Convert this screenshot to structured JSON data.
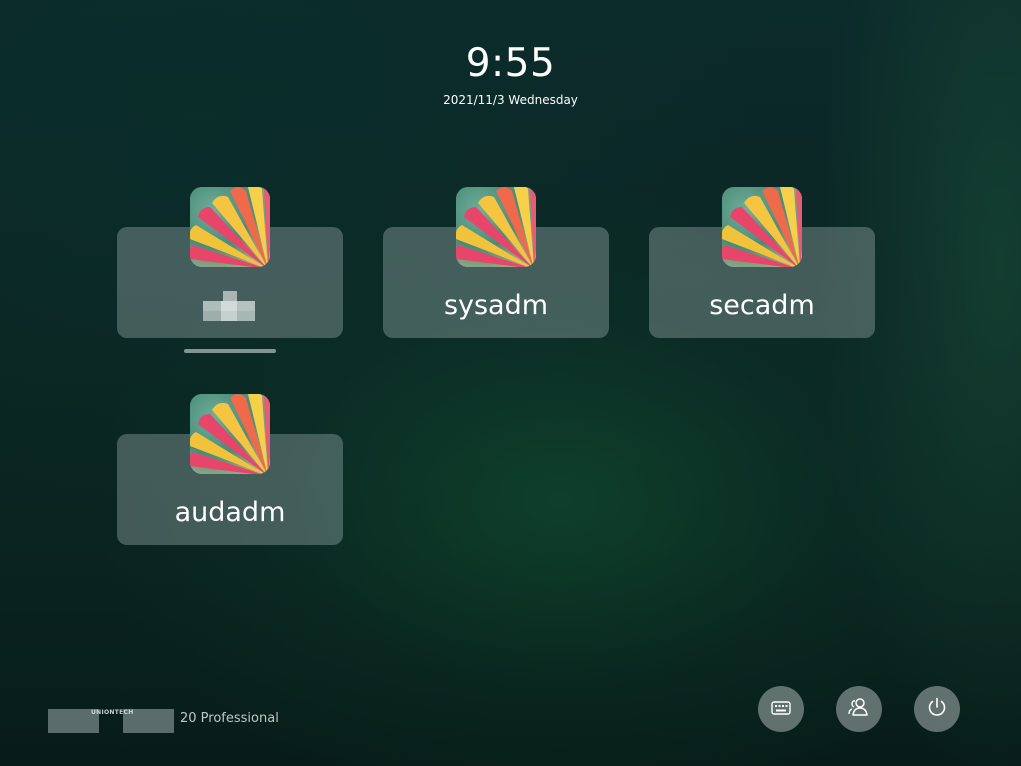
{
  "clock": {
    "time": "9:55",
    "date": "2021/11/3 Wednesday"
  },
  "users": [
    {
      "name": "",
      "current": true,
      "avatar": "flower-avatar-icon",
      "name_obscured": true
    },
    {
      "name": "sysadm",
      "current": false,
      "avatar": "flower-avatar-icon"
    },
    {
      "name": "secadm",
      "current": false,
      "avatar": "flower-avatar-icon"
    },
    {
      "name": "audadm",
      "current": false,
      "avatar": "flower-avatar-icon"
    }
  ],
  "branding": {
    "logo_text": "UNIONTECH",
    "edition": "20 Professional"
  },
  "actions": [
    {
      "id": "keyboard",
      "icon": "keyboard-icon"
    },
    {
      "id": "switch-user",
      "icon": "users-icon"
    },
    {
      "id": "power",
      "icon": "power-icon"
    }
  ],
  "colors": {
    "background": "#0b2624",
    "card": "#5f7472",
    "text": "#ffffff"
  }
}
